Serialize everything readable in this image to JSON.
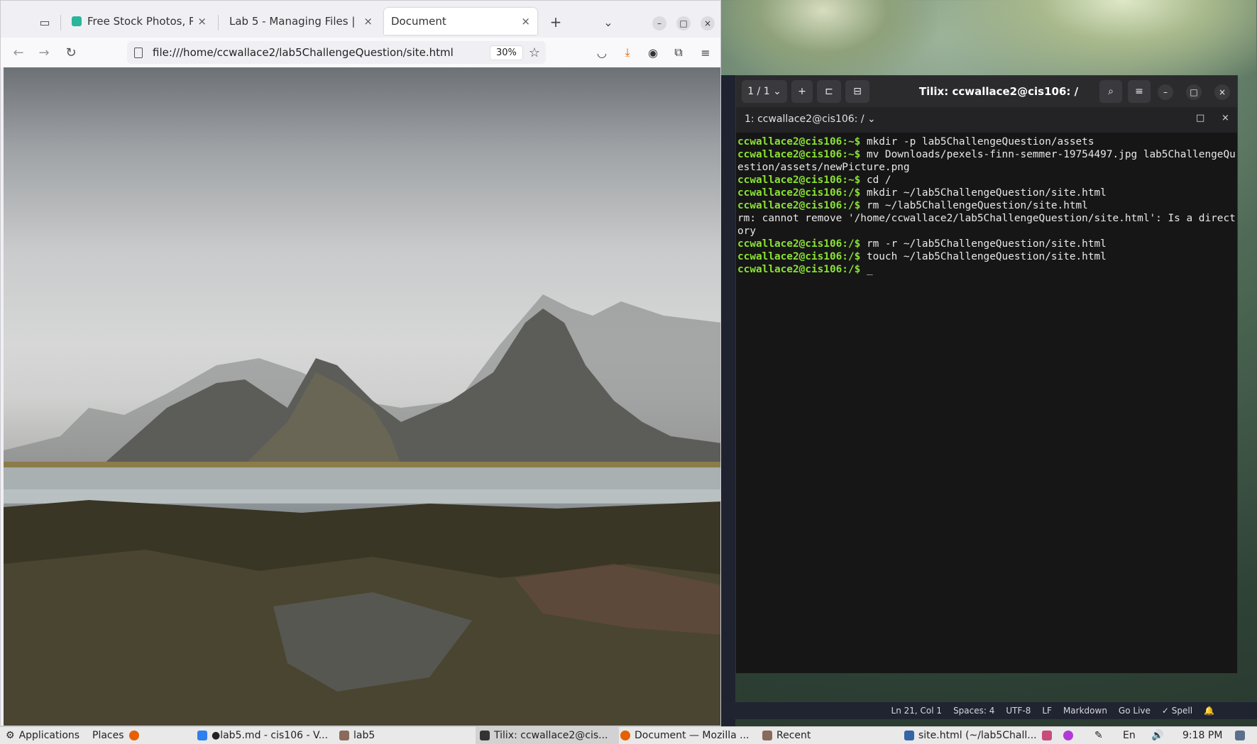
{
  "browser": {
    "tabs": [
      {
        "label": "Free Stock Photos, Royal",
        "close": "×"
      },
      {
        "label": "Lab 5 - Managing Files | Linu",
        "close": "×"
      },
      {
        "label": "Document",
        "close": "×"
      }
    ],
    "new_tab": "+",
    "list_tabs": "⌄",
    "url": "file:///home/ccwallace2/lab5ChallengeQuestion/site.html",
    "zoom": "30%",
    "window_controls": {
      "minimize": "–",
      "maximize": "□",
      "close": "×"
    }
  },
  "tilix": {
    "session_counter": "1 / 1",
    "title": "Tilix: ccwallace2@cis106: /",
    "terminal_tab": "1: ccwallace2@cis106: /",
    "lines": [
      {
        "prompt": "ccwallace2@cis106:~$",
        "cmd": " mkdir -p lab5ChallengeQuestion/assets"
      },
      {
        "prompt": "ccwallace2@cis106:~$",
        "cmd": " mv Downloads/pexels-finn-semmer-19754497.jpg lab5ChallengeQuestion/assets/newPicture.png"
      },
      {
        "prompt": "ccwallace2@cis106:~$",
        "cmd": " cd /"
      },
      {
        "prompt": "ccwallace2@cis106:/$",
        "cmd": " mkdir ~/lab5ChallengeQuestion/site.html"
      },
      {
        "prompt": "ccwallace2@cis106:/$",
        "cmd": " rm ~/lab5ChallengeQuestion/site.html"
      },
      {
        "prompt": "",
        "cmd": "rm: cannot remove '/home/ccwallace2/lab5ChallengeQuestion/site.html': Is a directory"
      },
      {
        "prompt": "ccwallace2@cis106:/$",
        "cmd": " rm -r ~/lab5ChallengeQuestion/site.html"
      },
      {
        "prompt": "ccwallace2@cis106:/$",
        "cmd": " touch ~/lab5ChallengeQuestion/site.html"
      },
      {
        "prompt": "ccwallace2@cis106:/$",
        "cmd": " _"
      }
    ]
  },
  "vscode_status": {
    "position": "Ln 21, Col 1",
    "spaces": "Spaces: 4",
    "encoding": "UTF-8",
    "eol": "LF",
    "language": "Markdown",
    "golive": "Go Live",
    "spell": "✓ Spell"
  },
  "taskbar": {
    "applications": "Applications",
    "places": "Places",
    "items": [
      {
        "label": "●lab5.md - cis106 - V..."
      },
      {
        "label": "lab5"
      },
      {
        "label": "Tilix: ccwallace2@cis..."
      },
      {
        "label": "Document — Mozilla ..."
      },
      {
        "label": "Recent"
      },
      {
        "label": "site.html (~/lab5Chall..."
      }
    ],
    "keyboard": "En",
    "clock": "9:18 PM"
  }
}
